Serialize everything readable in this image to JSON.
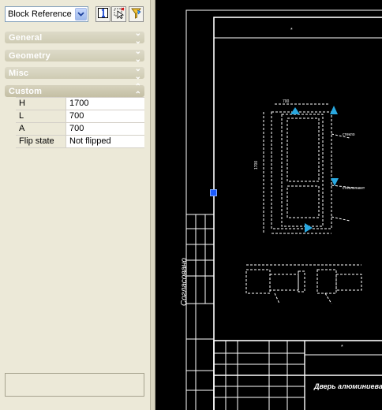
{
  "palette": {
    "object_type": "Block Reference",
    "toolbar": {
      "pickadd_icon": "pickadd-toggle-icon",
      "select_icon": "select-objects-icon",
      "quickselect_icon": "quick-select-icon"
    },
    "categories": [
      {
        "label": "General",
        "state": "collapsed"
      },
      {
        "label": "Geometry",
        "state": "collapsed"
      },
      {
        "label": "Misc",
        "state": "collapsed"
      },
      {
        "label": "Custom",
        "state": "expanded"
      }
    ],
    "custom_properties": [
      {
        "name": "H",
        "value": "1700"
      },
      {
        "name": "L",
        "value": "700"
      },
      {
        "name": "A",
        "value": "700"
      },
      {
        "name": "Flip state",
        "value": "Not flipped"
      }
    ]
  },
  "drawing": {
    "title_block_text": "Дверь алюминиевая",
    "side_label": "Согласовано",
    "colors": {
      "background": "#000000",
      "lines": "#ffffff",
      "grip": "#1c5cff",
      "arrow_grip": "#29a8e0"
    }
  }
}
